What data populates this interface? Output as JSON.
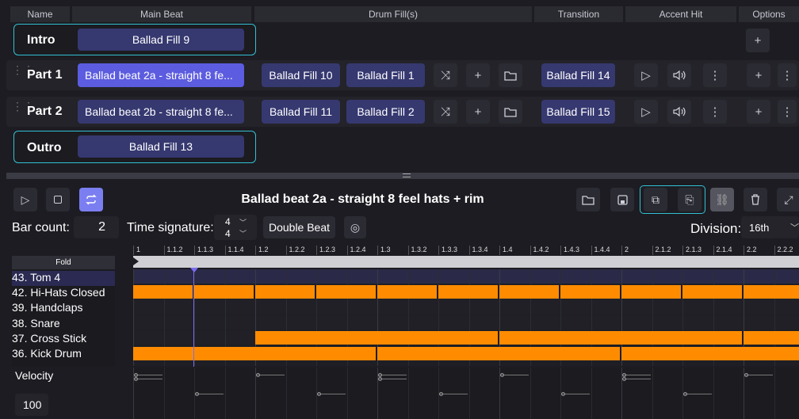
{
  "columns": {
    "name": "Name",
    "main": "Main Beat",
    "fills": "Drum Fill(s)",
    "transition": "Transition",
    "accent": "Accent Hit",
    "options": "Options"
  },
  "sections": [
    {
      "name": "Intro",
      "main": "Ballad Fill 9"
    },
    {
      "name": "Part 1",
      "main": "Ballad beat 2a - straight 8 fe...",
      "fill1": "Ballad Fill 10",
      "fill2": "Ballad Fill 1",
      "transition": "Ballad Fill 14"
    },
    {
      "name": "Part 2",
      "main": "Ballad beat 2b - straight 8 fe...",
      "fill1": "Ballad Fill 11",
      "fill2": "Ballad Fill 2",
      "transition": "Ballad Fill 15"
    },
    {
      "name": "Outro",
      "main": "Ballad Fill 13"
    }
  ],
  "editor": {
    "title": "Ballad beat 2a - straight 8 feel hats + rim",
    "bar_count_label": "Bar count:",
    "bar_count": "2",
    "time_sig_label": "Time signature:",
    "ts_top": "4",
    "ts_bottom": "4",
    "double_beat": "Double Beat",
    "division_label": "Division:",
    "division": "16th",
    "fold": "Fold",
    "velocity_label": "Velocity",
    "velocity": "100"
  },
  "ruler": [
    "1",
    "1.1.2",
    "1.1.3",
    "1.1.4",
    "1.2",
    "1.2.2",
    "1.2.3",
    "1.2.4",
    "1.3",
    "1.3.2",
    "1.3.3",
    "1.3.4",
    "1.4",
    "1.4.2",
    "1.4.3",
    "1.4.4",
    "2",
    "2.1.2",
    "2.1.3",
    "2.1.4",
    "2.2",
    "2.2.2"
  ],
  "tracks": [
    "43. Tom 4",
    "42. Hi-Hats Closed",
    "39. Handclaps",
    "38. Snare",
    "37. Cross Stick",
    "36. Kick Drum"
  ],
  "colors": {
    "accent": "#33c1d3",
    "note": "#ff8c00",
    "selected": "#5c5ce0",
    "beat": "#363870"
  },
  "pattern": {
    "hihat_steps": [
      0,
      2,
      4,
      6,
      8,
      10,
      12,
      14,
      16,
      18,
      20
    ],
    "cross_stick_steps": [
      4,
      12,
      20
    ],
    "kick_steps": [
      0,
      8,
      16
    ]
  }
}
